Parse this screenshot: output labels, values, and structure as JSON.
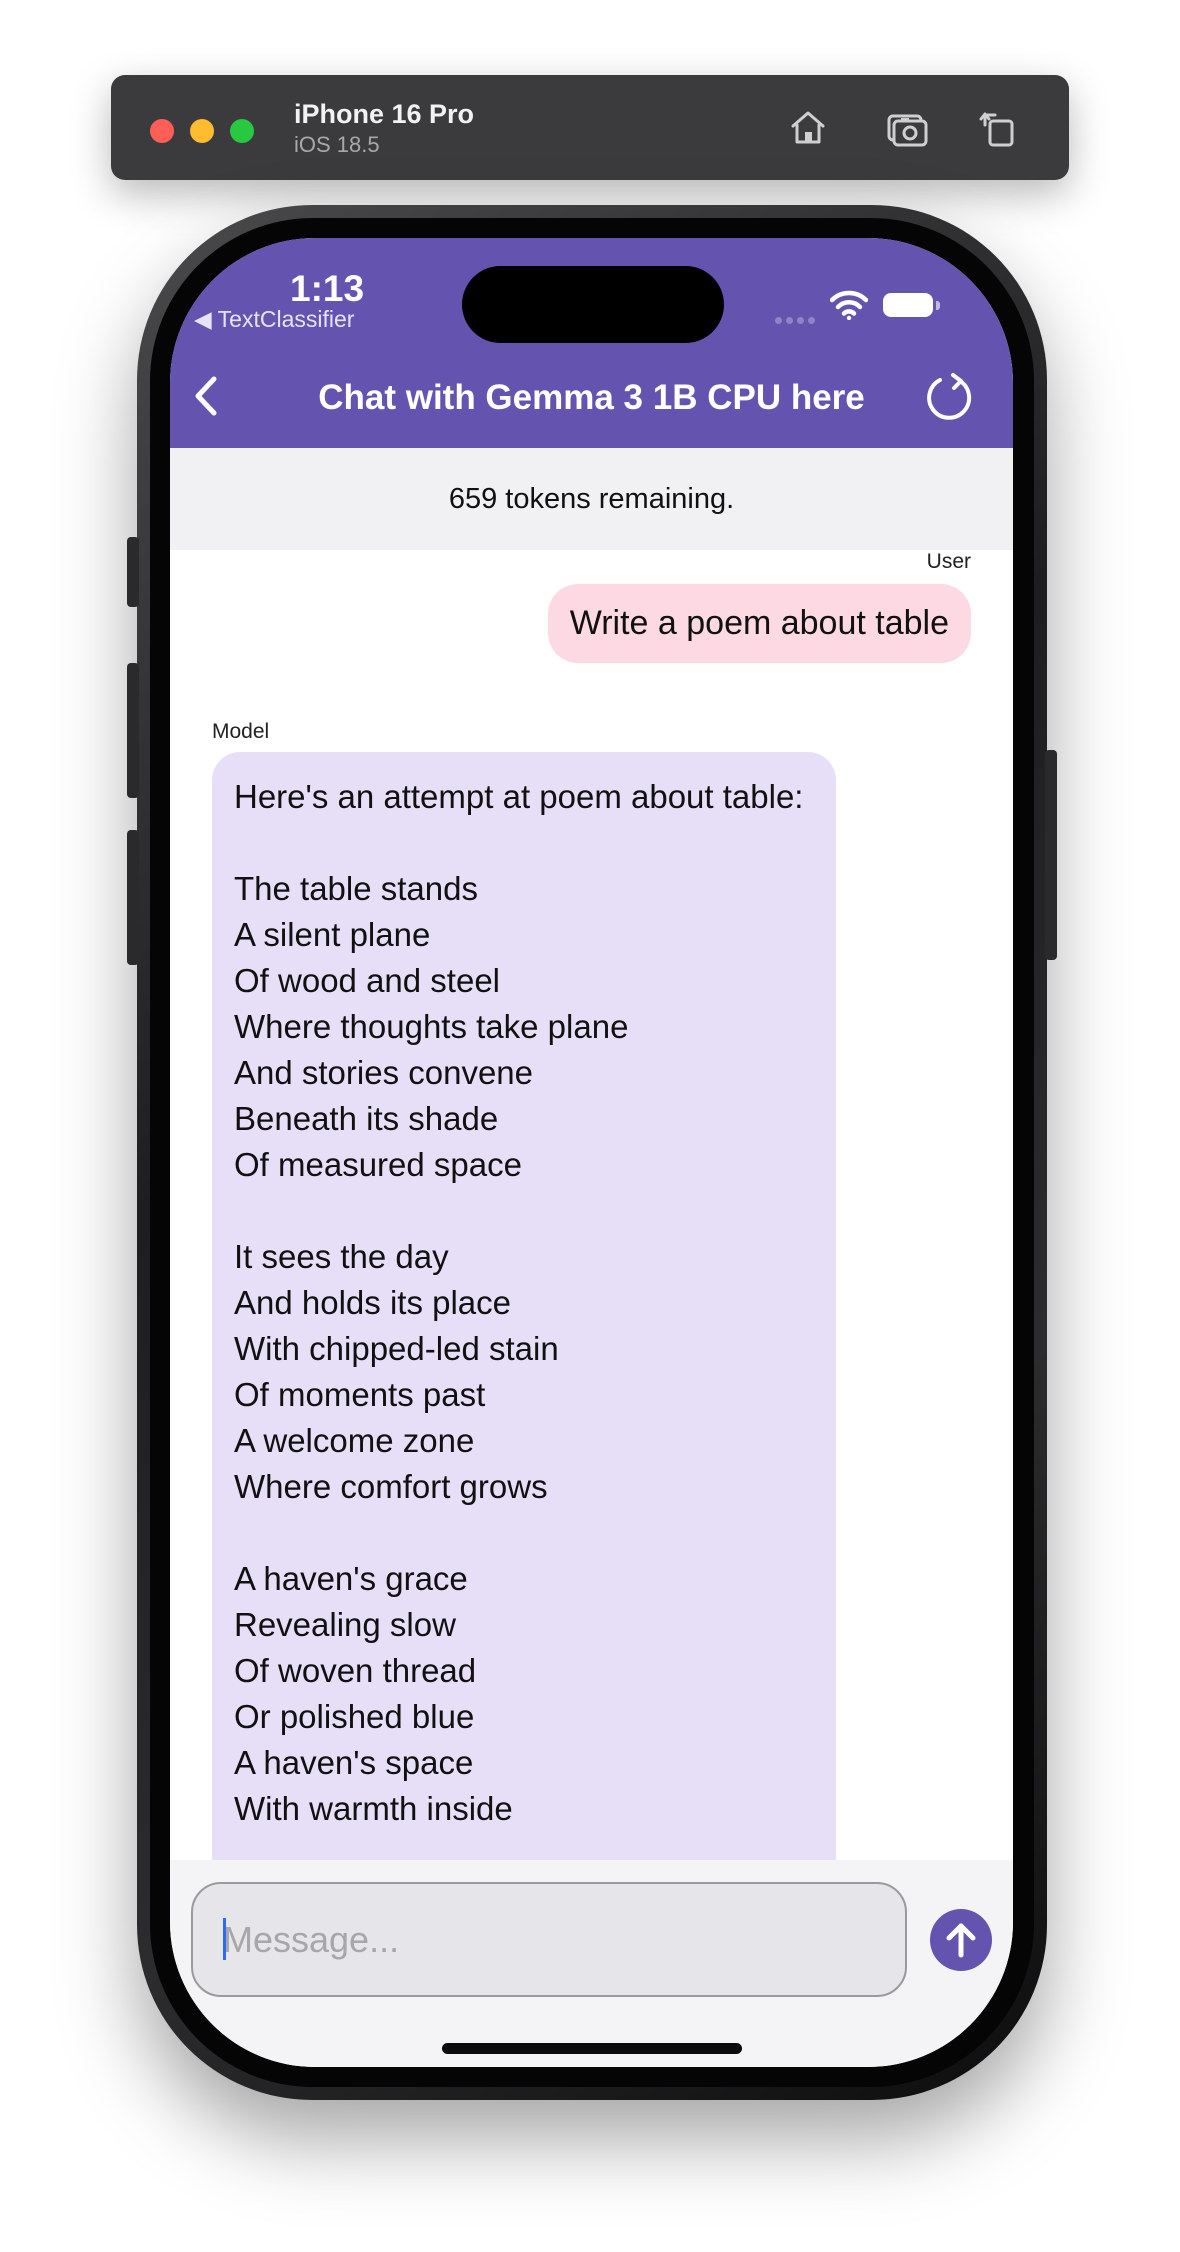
{
  "simulator": {
    "device_name": "iPhone 16 Pro",
    "os_version": "iOS 18.5",
    "buttons": [
      "home-icon",
      "screenshot-icon",
      "rotate-icon"
    ]
  },
  "status_bar": {
    "time": "1:13",
    "back_app": "◀ TextClassifier"
  },
  "nav": {
    "title": "Chat with Gemma 3 1B CPU here"
  },
  "tokens": {
    "remaining_text": "659 tokens remaining."
  },
  "messages": [
    {
      "sender": "User",
      "text": "Write a poem about table"
    },
    {
      "sender": "Model",
      "text": "Here's an attempt at poem about table:\n\nThe table stands\nA silent plane\nOf wood and steel\nWhere thoughts take plane\nAnd stories convene\nBeneath its shade\nOf measured space\n\nIt sees the day\nAnd holds its place\nWith chipped-led stain\nOf moments past\nA welcome zone\nWhere comfort grows\n\nA haven's grace\nRevealing slow\nOf woven thread\nOr polished blue\nA haven's space\nWith warmth inside"
    }
  ],
  "composer": {
    "placeholder": "Message...",
    "value": ""
  },
  "colors": {
    "header": "#6554af",
    "user_bubble": "#fdd9e3",
    "model_bubble": "#e6dff7",
    "send_button": "#6554af"
  }
}
